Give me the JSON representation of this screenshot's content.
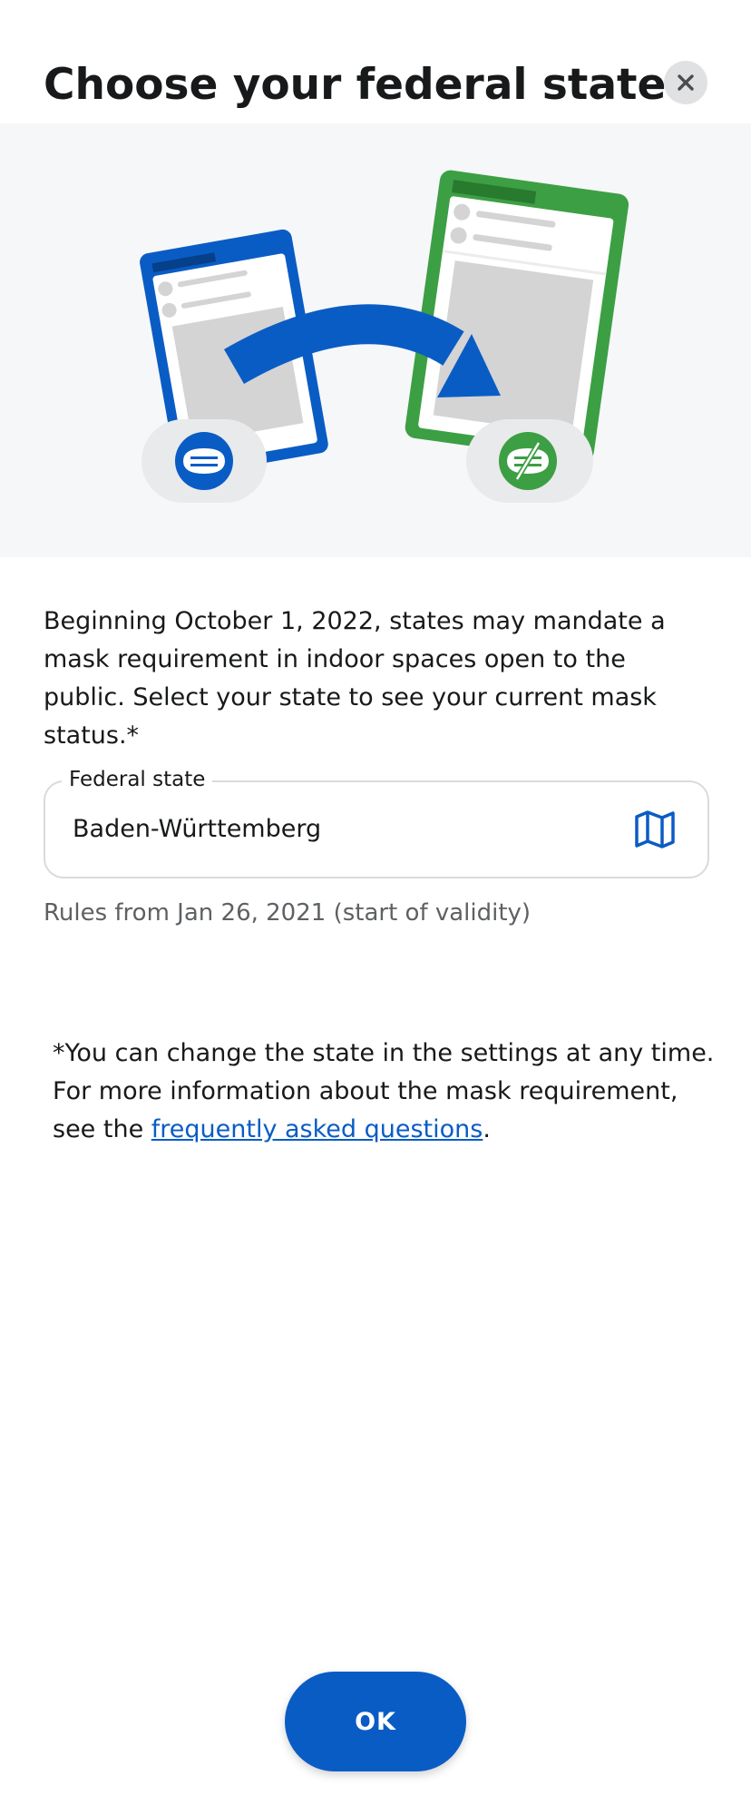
{
  "header": {
    "title": "Choose your federal state",
    "close_icon": "close-icon"
  },
  "illustration": {
    "left_phone_color": "#0a5cc5",
    "right_phone_color": "#3c9f44",
    "arrow_color": "#0a5cc5",
    "left_badge_icon": "mask-icon",
    "right_badge_icon": "mask-off-icon"
  },
  "intro": {
    "text": "Beginning October 1, 2022, states may mandate a mask requirement in indoor spaces open to the public. Select your state to see your current mask status.*"
  },
  "state_field": {
    "label": "Federal state",
    "value": "Baden-Württemberg",
    "icon": "map-icon"
  },
  "rules": {
    "text": "Rules from Jan 26, 2021 (start of validity)"
  },
  "footnote": {
    "text_before": "*You can change the state in the settings at any time. For more information about the mask requirement, see the ",
    "link_text": "frequently asked questions",
    "text_after": "."
  },
  "actions": {
    "ok_label": "OK"
  },
  "colors": {
    "accent": "#0a5cc5",
    "green": "#3c9f44",
    "illustration_bg": "#f6f7f8"
  }
}
